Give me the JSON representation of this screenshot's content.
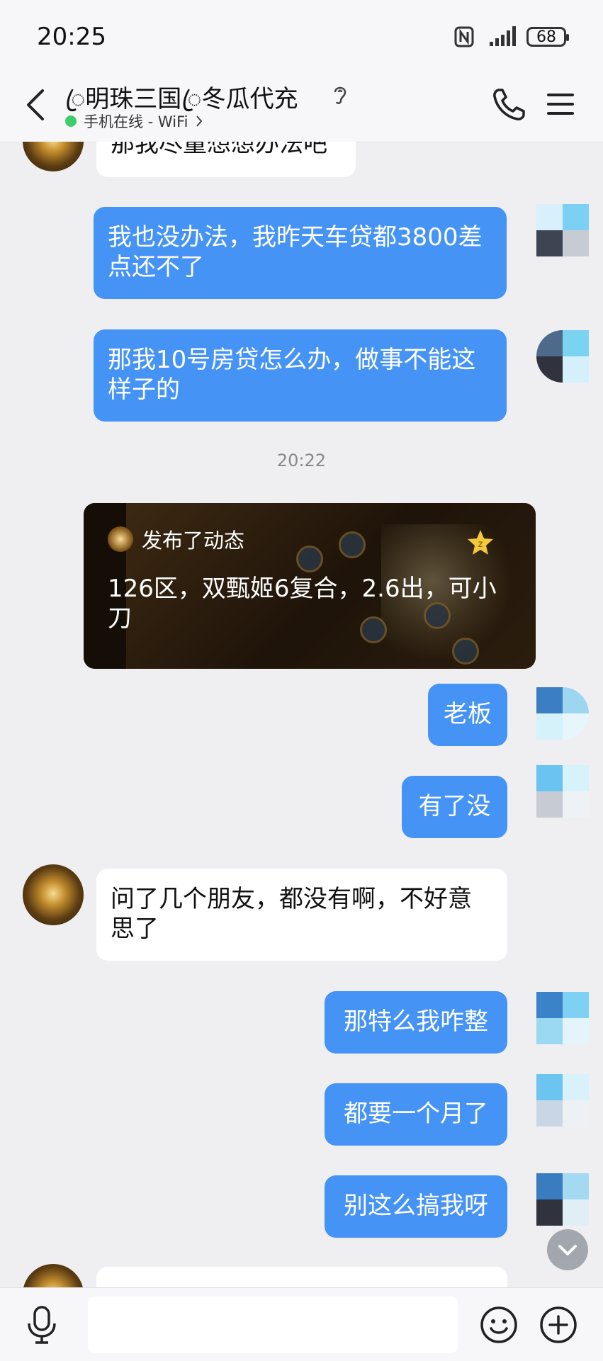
{
  "status_bar": {
    "time": "20:25",
    "battery": "68"
  },
  "header": {
    "title": "ꦿ明珠三国ꦿ冬瓜代充",
    "online_status": "手机在线 - WiFi"
  },
  "messages": {
    "m0_in": "那我尽量想想办法吧",
    "m1_out": "我也没办法，我昨天车贷都3800差点还不了",
    "m2_out": "那我10号房贷怎么办，做事不能这样子的",
    "timestamp": "20:22",
    "card_title": "发布了动态",
    "card_text": "126区，双甄姬6复合，2.6出，可小刀",
    "m3_out": "老板",
    "m4_out": "有了没",
    "m5_in": "问了几个朋友，都没有啊，不好意思了",
    "m6_out": "那特么我咋整",
    "m7_out": "都要一个月了",
    "m8_out": "别这么搞我呀"
  },
  "input": {
    "placeholder": ""
  },
  "colors": {
    "outgoing_bubble": "#4693f6",
    "incoming_bubble": "#ffffff",
    "background": "#efeff1",
    "online_dot": "#3dcd6b"
  }
}
